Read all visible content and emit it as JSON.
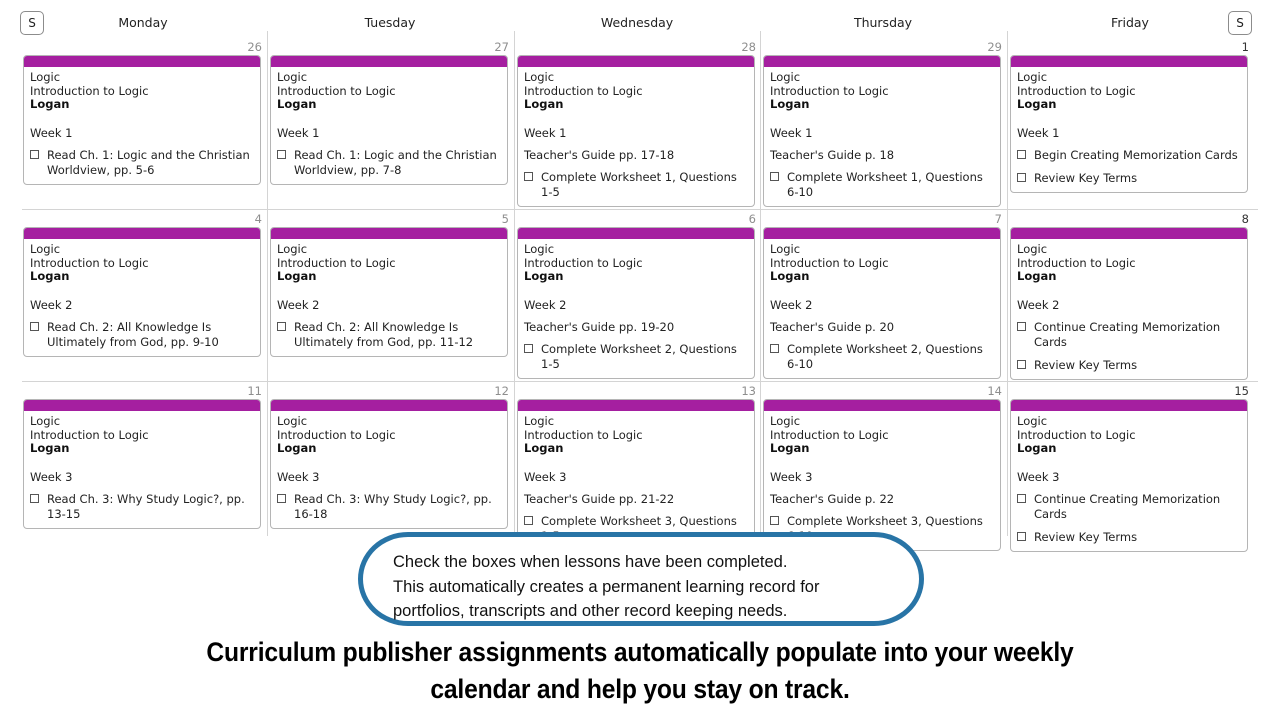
{
  "header": {
    "saturday_button": "S",
    "sunday_button": "S",
    "days": [
      "Monday",
      "Tuesday",
      "Wednesday",
      "Thursday",
      "Friday"
    ]
  },
  "accent_colors": {
    "event_bar_purple": "#a51fa0",
    "callout_blue": "#2874a6",
    "grid_line": "#d4d4d4",
    "date_number": "#8e8e8e"
  },
  "weeks": [
    {
      "days": [
        {
          "date": "26",
          "course": "Logic",
          "title": "Introduction to Logic",
          "student": "Logan",
          "week": "Week 1",
          "note": "",
          "tasks": [
            "Read Ch. 1: Logic and the Christian Worldview, pp. 5-6"
          ]
        },
        {
          "date": "27",
          "course": "Logic",
          "title": "Introduction to Logic",
          "student": "Logan",
          "week": "Week 1",
          "note": "",
          "tasks": [
            "Read Ch. 1: Logic and the Christian Worldview, pp. 7-8"
          ]
        },
        {
          "date": "28",
          "course": "Logic",
          "title": "Introduction to Logic",
          "student": "Logan",
          "week": "Week 1",
          "note": "Teacher's Guide pp. 17-18",
          "tasks": [
            "Complete Worksheet 1, Questions 1-5"
          ]
        },
        {
          "date": "29",
          "course": "Logic",
          "title": "Introduction to Logic",
          "student": "Logan",
          "week": "Week 1",
          "note": "Teacher's Guide p. 18",
          "tasks": [
            "Complete Worksheet 1, Questions 6-10"
          ]
        },
        {
          "date": "1",
          "course": "Logic",
          "title": "Introduction to Logic",
          "student": "Logan",
          "week": "Week 1",
          "note": "",
          "tasks": [
            "Begin Creating Memorization Cards",
            "Review Key Terms"
          ]
        }
      ]
    },
    {
      "days": [
        {
          "date": "4",
          "course": "Logic",
          "title": "Introduction to Logic",
          "student": "Logan",
          "week": "Week 2",
          "note": "",
          "tasks": [
            "Read Ch. 2: All Knowledge Is Ultimately from God, pp. 9-10"
          ]
        },
        {
          "date": "5",
          "course": "Logic",
          "title": "Introduction to Logic",
          "student": "Logan",
          "week": "Week 2",
          "note": "",
          "tasks": [
            "Read Ch. 2: All Knowledge Is Ultimately from God, pp. 11-12"
          ]
        },
        {
          "date": "6",
          "course": "Logic",
          "title": "Introduction to Logic",
          "student": "Logan",
          "week": "Week 2",
          "note": "Teacher's Guide pp. 19-20",
          "tasks": [
            "Complete Worksheet 2, Questions 1-5"
          ]
        },
        {
          "date": "7",
          "course": "Logic",
          "title": "Introduction to Logic",
          "student": "Logan",
          "week": "Week 2",
          "note": "Teacher's Guide p. 20",
          "tasks": [
            "Complete Worksheet 2, Questions 6-10"
          ]
        },
        {
          "date": "8",
          "course": "Logic",
          "title": "Introduction to Logic",
          "student": "Logan",
          "week": "Week 2",
          "note": "",
          "tasks": [
            "Continue Creating Memorization Cards",
            "Review Key Terms"
          ]
        }
      ]
    },
    {
      "days": [
        {
          "date": "11",
          "course": "Logic",
          "title": "Introduction to Logic",
          "student": "Logan",
          "week": "Week 3",
          "note": "",
          "tasks": [
            "Read Ch. 3: Why Study Logic?, pp. 13-15"
          ]
        },
        {
          "date": "12",
          "course": "Logic",
          "title": "Introduction to Logic",
          "student": "Logan",
          "week": "Week 3",
          "note": "",
          "tasks": [
            "Read Ch. 3: Why Study Logic?, pp. 16-18"
          ]
        },
        {
          "date": "13",
          "course": "Logic",
          "title": "Introduction to Logic",
          "student": "Logan",
          "week": "Week 3",
          "note": "Teacher's Guide pp. 21-22",
          "tasks": [
            "Complete Worksheet 3, Questions 1-5"
          ]
        },
        {
          "date": "14",
          "course": "Logic",
          "title": "Introduction to Logic",
          "student": "Logan",
          "week": "Week 3",
          "note": "Teacher's Guide p. 22",
          "tasks": [
            "Complete Worksheet 3, Questions 6-10"
          ]
        },
        {
          "date": "15",
          "course": "Logic",
          "title": "Introduction to Logic",
          "student": "Logan",
          "week": "Week 3",
          "note": "",
          "tasks": [
            "Continue Creating Memorization Cards",
            "Review Key Terms"
          ]
        }
      ]
    }
  ],
  "callout": {
    "line1": "Check the boxes when lessons have been completed.",
    "line2": "This automatically creates a permanent learning record for",
    "line3": "portfolios, transcripts and other record keeping needs."
  },
  "tagline": {
    "line1": "Curriculum publisher assignments automatically populate into your weekly",
    "line2": "calendar and help you stay on track."
  }
}
